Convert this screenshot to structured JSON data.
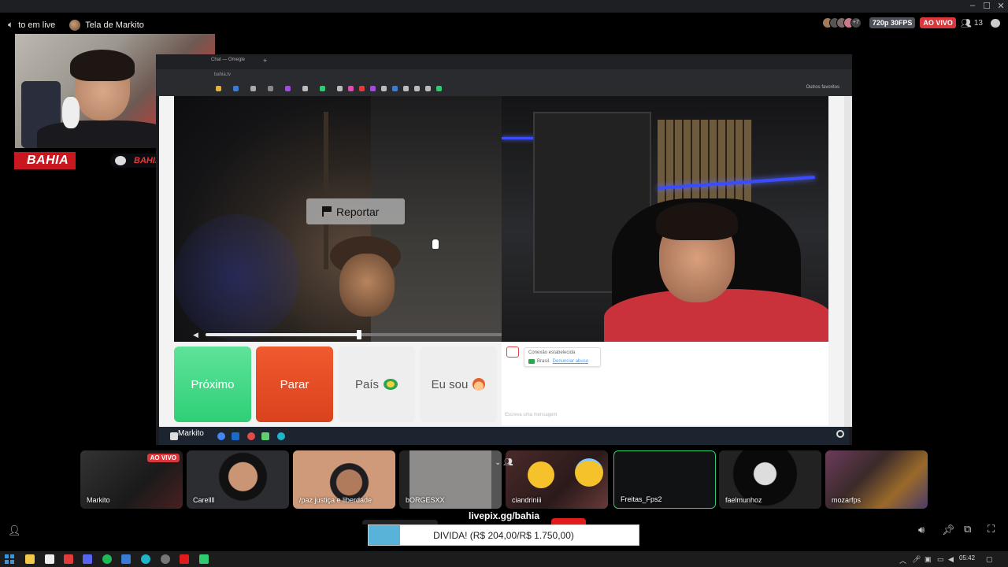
{
  "window": {
    "controls": [
      "–",
      "☐",
      "✕"
    ]
  },
  "stream": {
    "channel_label": "to em live",
    "screen_share_label": "Tela de Markito",
    "quality": "720p 30FPS",
    "live_badge": "AO VIVO",
    "extra_viewers": "+7",
    "viewer_count": "13"
  },
  "overlay": {
    "brand_left": "BAHIA",
    "brand_right": "BAHIAFPSS"
  },
  "browser": {
    "tab_title": "Chat — Omegle",
    "url": "bahia.tv",
    "bookmarks_right": "Outros favoritos"
  },
  "app": {
    "report_label": "Reportar",
    "progress": 0.5,
    "next_label": "Próximo",
    "stop_label": "Parar",
    "country_label": "País",
    "iam_label": "Eu sou",
    "chat": {
      "status": "Conexão estabelecida",
      "country": "Brasil.",
      "report_link": "Denunciar abuso",
      "input_placeholder": "Escreva uma mensagem"
    }
  },
  "shared_taskbar": {
    "user": "Markito"
  },
  "participants": [
    {
      "name": "Markito",
      "live": "AO VIVO"
    },
    {
      "name": "Carellll"
    },
    {
      "name": "/paz justiça e liberdade"
    },
    {
      "name": "bORGESXX"
    },
    {
      "name": "ciandriniii"
    },
    {
      "name": "Freitas_Fps2"
    },
    {
      "name": "faelmunhoz"
    },
    {
      "name": "mozarfps"
    }
  ],
  "livepix": {
    "label": "livepix.gg/bahia",
    "goal_text": "DIVIDA! (R$ 204,00/R$ 1.750,00)",
    "raised": 204.0,
    "goal": 1750.0,
    "fill_color": "#59b3d9"
  },
  "taskbar": {
    "clock": "05:42"
  }
}
